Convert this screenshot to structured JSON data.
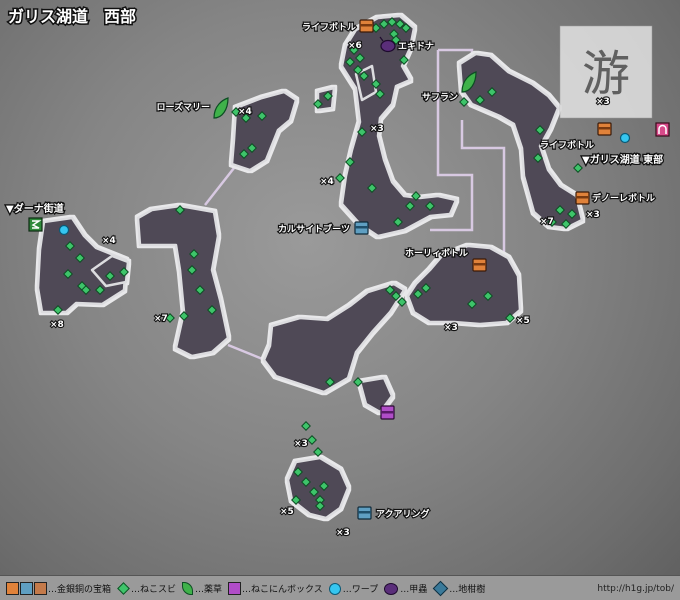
{
  "title": "ガリス湖道　西部",
  "exits": {
    "west": "▼ダーナ街道",
    "east": "▼ガリス湖道 東部"
  },
  "watermark": "游",
  "labels": {
    "life_bottle": "ライフボトル",
    "ekidona": "エキドナ",
    "rosemary": "ローズマリー",
    "saffron": "サフラン",
    "life_bottle_2": "ライフボトル",
    "deno_bottle": "デノーレボトル",
    "calcite_boots": "カルサイトブーツ",
    "holy_bottle": "ホーリィボトル",
    "aquaring": "アクアリング"
  },
  "counts": {
    "c1": "×6",
    "c2": "×4",
    "c3": "×3",
    "c4": "×4",
    "c5": "×3",
    "c6": "×7",
    "c7": "×3",
    "c8": "×4",
    "c9": "×8",
    "c10": "×7",
    "c11": "×3",
    "c12": "×5",
    "c13": "×3",
    "c14": "×5",
    "c15": "×3"
  },
  "legend": {
    "chest": "…金銀銅の宝箱",
    "cat_gem": "…ねこスビ",
    "herb": "…薬草",
    "cat_box": "…ねこにんボックス",
    "warp": "…ワープ",
    "beetle": "…甲蟲",
    "tree": "…地柑樹",
    "url": "http://h1g.jp/tob/"
  },
  "colors": {
    "area": "#4f4a56",
    "gem": "#3ec46a",
    "chest_gold": "#e0823a",
    "chest_silver": "#5f9fc2",
    "catbox": "#b04dc8",
    "warp": "#35c6f0",
    "route": "#d8c9e2"
  }
}
